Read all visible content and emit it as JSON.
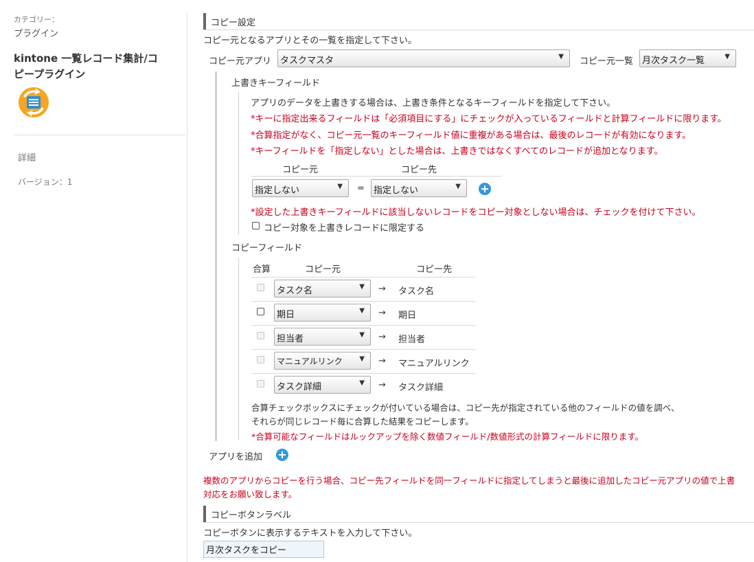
{
  "sidebar": {
    "category_label": "カテゴリー：",
    "category_value": "プラグイン",
    "plugin_title_line1": "kintone 一覧レコード集計/コ",
    "plugin_title_line2": "ピープラグイン",
    "details_label": "詳細",
    "version_label": "バージョン：1"
  },
  "copy_settings": {
    "header": "コピー設定",
    "description": "コピー元となるアプリとその一覧を指定して下さい。",
    "source_app_label": "コピー元アプリ",
    "source_app_value": "タスクマスタ",
    "source_list_label": "コピー元一覧",
    "source_list_value": "月次タスク一覧"
  },
  "overwrite_key": {
    "header": "上書きキーフィールド",
    "description": "アプリのデータを上書きする場合は、上書き条件となるキーフィールドを指定して下さい。",
    "note1": "*キーに指定出来るフィールドは「必須項目にする」にチェックが入っているフィールドと計算フィールドに限ります。",
    "note2": "*合算指定がなく、コピー元一覧のキーフィールド値に重複がある場合は、最後のレコードが有効になります。",
    "note3": "*キーフィールドを「指定しない」とした場合は、上書きではなくすべてのレコードが追加となります。",
    "col_source": "コピー元",
    "col_dest": "コピー先",
    "source_value": "指定しない",
    "equals": "=",
    "dest_value": "指定しない",
    "note4": "*設定した上書きキーフィールドに該当しないレコードをコピー対象としない場合は、チェックを付けて下さい。",
    "limit_checkbox_label": "コピー対象を上書きレコードに限定する"
  },
  "copy_fields": {
    "header": "コピーフィールド",
    "col_sum": "合算",
    "col_source": "コピー元",
    "col_dest": "コピー先",
    "arrow": "→",
    "rows": [
      {
        "source": "タスク名",
        "dest": "タスク名",
        "sum_enabled": false
      },
      {
        "source": "期日",
        "dest": "期日",
        "sum_enabled": true
      },
      {
        "source": "担当者",
        "dest": "担当者",
        "sum_enabled": false
      },
      {
        "source": "マニュアルリンク",
        "dest": "マニュアルリンク",
        "sum_enabled": false
      },
      {
        "source": "タスク詳細",
        "dest": "タスク詳細",
        "sum_enabled": false
      }
    ],
    "note_line1": "合算チェックボックスにチェックが付いている場合は、コピー先が指定されている他のフィールドの値を調べ、",
    "note_line2": "それらが同じレコード毎に合算した結果をコピーします。",
    "note_red": "*合算可能なフィールドはルックアップを除く数値フィールド/数値形式の計算フィールドに限ります。"
  },
  "add_app": {
    "label": "アプリを追加"
  },
  "warning": {
    "line1": "複数のアプリからコピーを行う場合、コピー先フィールドを同一フィールドに指定してしまうと最後に追加したコピー元アプリの値で上書",
    "line2": "対応をお願い致します。"
  },
  "button_label": {
    "header": "コピーボタンラベル",
    "description": "コピーボタンに表示するテキストを入力して下さい。",
    "input_value": "月次タスクをコピー"
  },
  "colors": {
    "note_red": "#c8001c",
    "accent_blue": "#3498db"
  }
}
